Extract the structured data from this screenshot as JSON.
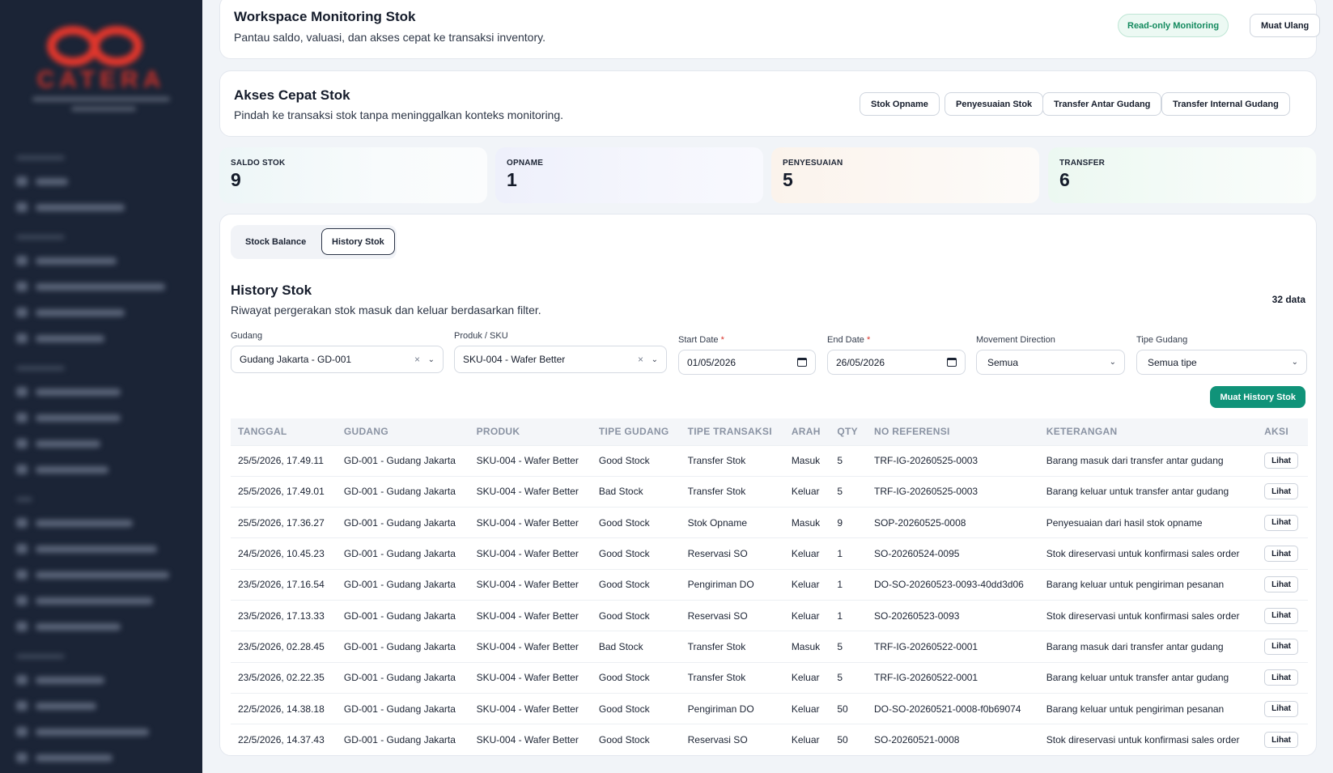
{
  "header": {
    "title": "Workspace Monitoring Stok",
    "subtitle": "Pantau saldo, valuasi, dan akses cepat ke transaksi inventory.",
    "badge": "Read-only Monitoring",
    "reload_label": "Muat Ulang"
  },
  "quick_access": {
    "title": "Akses Cepat Stok",
    "subtitle": "Pindah ke transaksi stok tanpa meninggalkan konteks monitoring.",
    "buttons": [
      "Stok Opname",
      "Penyesuaian Stok",
      "Transfer Antar Gudang",
      "Transfer Internal Gudang"
    ]
  },
  "stats": [
    {
      "label": "SALDO STOK",
      "value": "9"
    },
    {
      "label": "OPNAME",
      "value": "1"
    },
    {
      "label": "PENYESUAIAN",
      "value": "5"
    },
    {
      "label": "TRANSFER",
      "value": "6"
    }
  ],
  "tabs": [
    "Stock Balance",
    "History Stok"
  ],
  "history": {
    "title": "History Stok",
    "subtitle": "Riwayat pergerakan stok masuk dan keluar berdasarkan filter.",
    "count": "32 data",
    "load_button": "Muat History Stok"
  },
  "filters": {
    "gudang": {
      "label": "Gudang",
      "value": "Gudang Jakarta - GD-001"
    },
    "produk": {
      "label": "Produk / SKU",
      "value": "SKU-004 - Wafer Better"
    },
    "start_date": {
      "label": "Start Date",
      "value": "01/05/2026"
    },
    "end_date": {
      "label": "End Date",
      "value": "26/05/2026"
    },
    "direction": {
      "label": "Movement Direction",
      "value": "Semua"
    },
    "tipe_gudang": {
      "label": "Tipe Gudang",
      "value": "Semua tipe"
    }
  },
  "table": {
    "columns": [
      "TANGGAL",
      "GUDANG",
      "PRODUK",
      "TIPE GUDANG",
      "TIPE TRANSAKSI",
      "ARAH",
      "QTY",
      "NO REFERENSI",
      "KETERANGAN",
      "AKSI"
    ],
    "action_label": "Lihat",
    "rows": [
      [
        "25/5/2026, 17.49.11",
        "GD-001 - Gudang Jakarta",
        "SKU-004 - Wafer Better",
        "Good Stock",
        "Transfer Stok",
        "Masuk",
        "5",
        "TRF-IG-20260525-0003",
        "Barang masuk dari transfer antar gudang"
      ],
      [
        "25/5/2026, 17.49.01",
        "GD-001 - Gudang Jakarta",
        "SKU-004 - Wafer Better",
        "Bad Stock",
        "Transfer Stok",
        "Keluar",
        "5",
        "TRF-IG-20260525-0003",
        "Barang keluar untuk transfer antar gudang"
      ],
      [
        "25/5/2026, 17.36.27",
        "GD-001 - Gudang Jakarta",
        "SKU-004 - Wafer Better",
        "Good Stock",
        "Stok Opname",
        "Masuk",
        "9",
        "SOP-20260525-0008",
        "Penyesuaian dari hasil stok opname"
      ],
      [
        "24/5/2026, 10.45.23",
        "GD-001 - Gudang Jakarta",
        "SKU-004 - Wafer Better",
        "Good Stock",
        "Reservasi SO",
        "Keluar",
        "1",
        "SO-20260524-0095",
        "Stok direservasi untuk konfirmasi sales order"
      ],
      [
        "23/5/2026, 17.16.54",
        "GD-001 - Gudang Jakarta",
        "SKU-004 - Wafer Better",
        "Good Stock",
        "Pengiriman DO",
        "Keluar",
        "1",
        "DO-SO-20260523-0093-40dd3d06",
        "Barang keluar untuk pengiriman pesanan"
      ],
      [
        "23/5/2026, 17.13.33",
        "GD-001 - Gudang Jakarta",
        "SKU-004 - Wafer Better",
        "Good Stock",
        "Reservasi SO",
        "Keluar",
        "1",
        "SO-20260523-0093",
        "Stok direservasi untuk konfirmasi sales order"
      ],
      [
        "23/5/2026, 02.28.45",
        "GD-001 - Gudang Jakarta",
        "SKU-004 - Wafer Better",
        "Bad Stock",
        "Transfer Stok",
        "Masuk",
        "5",
        "TRF-IG-20260522-0001",
        "Barang masuk dari transfer antar gudang"
      ],
      [
        "23/5/2026, 02.22.35",
        "GD-001 - Gudang Jakarta",
        "SKU-004 - Wafer Better",
        "Good Stock",
        "Transfer Stok",
        "Keluar",
        "5",
        "TRF-IG-20260522-0001",
        "Barang keluar untuk transfer antar gudang"
      ],
      [
        "22/5/2026, 14.38.18",
        "GD-001 - Gudang Jakarta",
        "SKU-004 - Wafer Better",
        "Good Stock",
        "Pengiriman DO",
        "Keluar",
        "50",
        "DO-SO-20260521-0008-f0b69074",
        "Barang keluar untuk pengiriman pesanan"
      ],
      [
        "22/5/2026, 14.37.43",
        "GD-001 - Gudang Jakarta",
        "SKU-004 - Wafer Better",
        "Good Stock",
        "Reservasi SO",
        "Keluar",
        "50",
        "SO-20260521-0008",
        "Stok direservasi untuk konfirmasi sales order"
      ]
    ]
  },
  "colors": {
    "sidebar_bg": "#1b2436",
    "accent_green": "#109379",
    "badge_green": "#138a5e",
    "logo_red": "#e0362c"
  }
}
